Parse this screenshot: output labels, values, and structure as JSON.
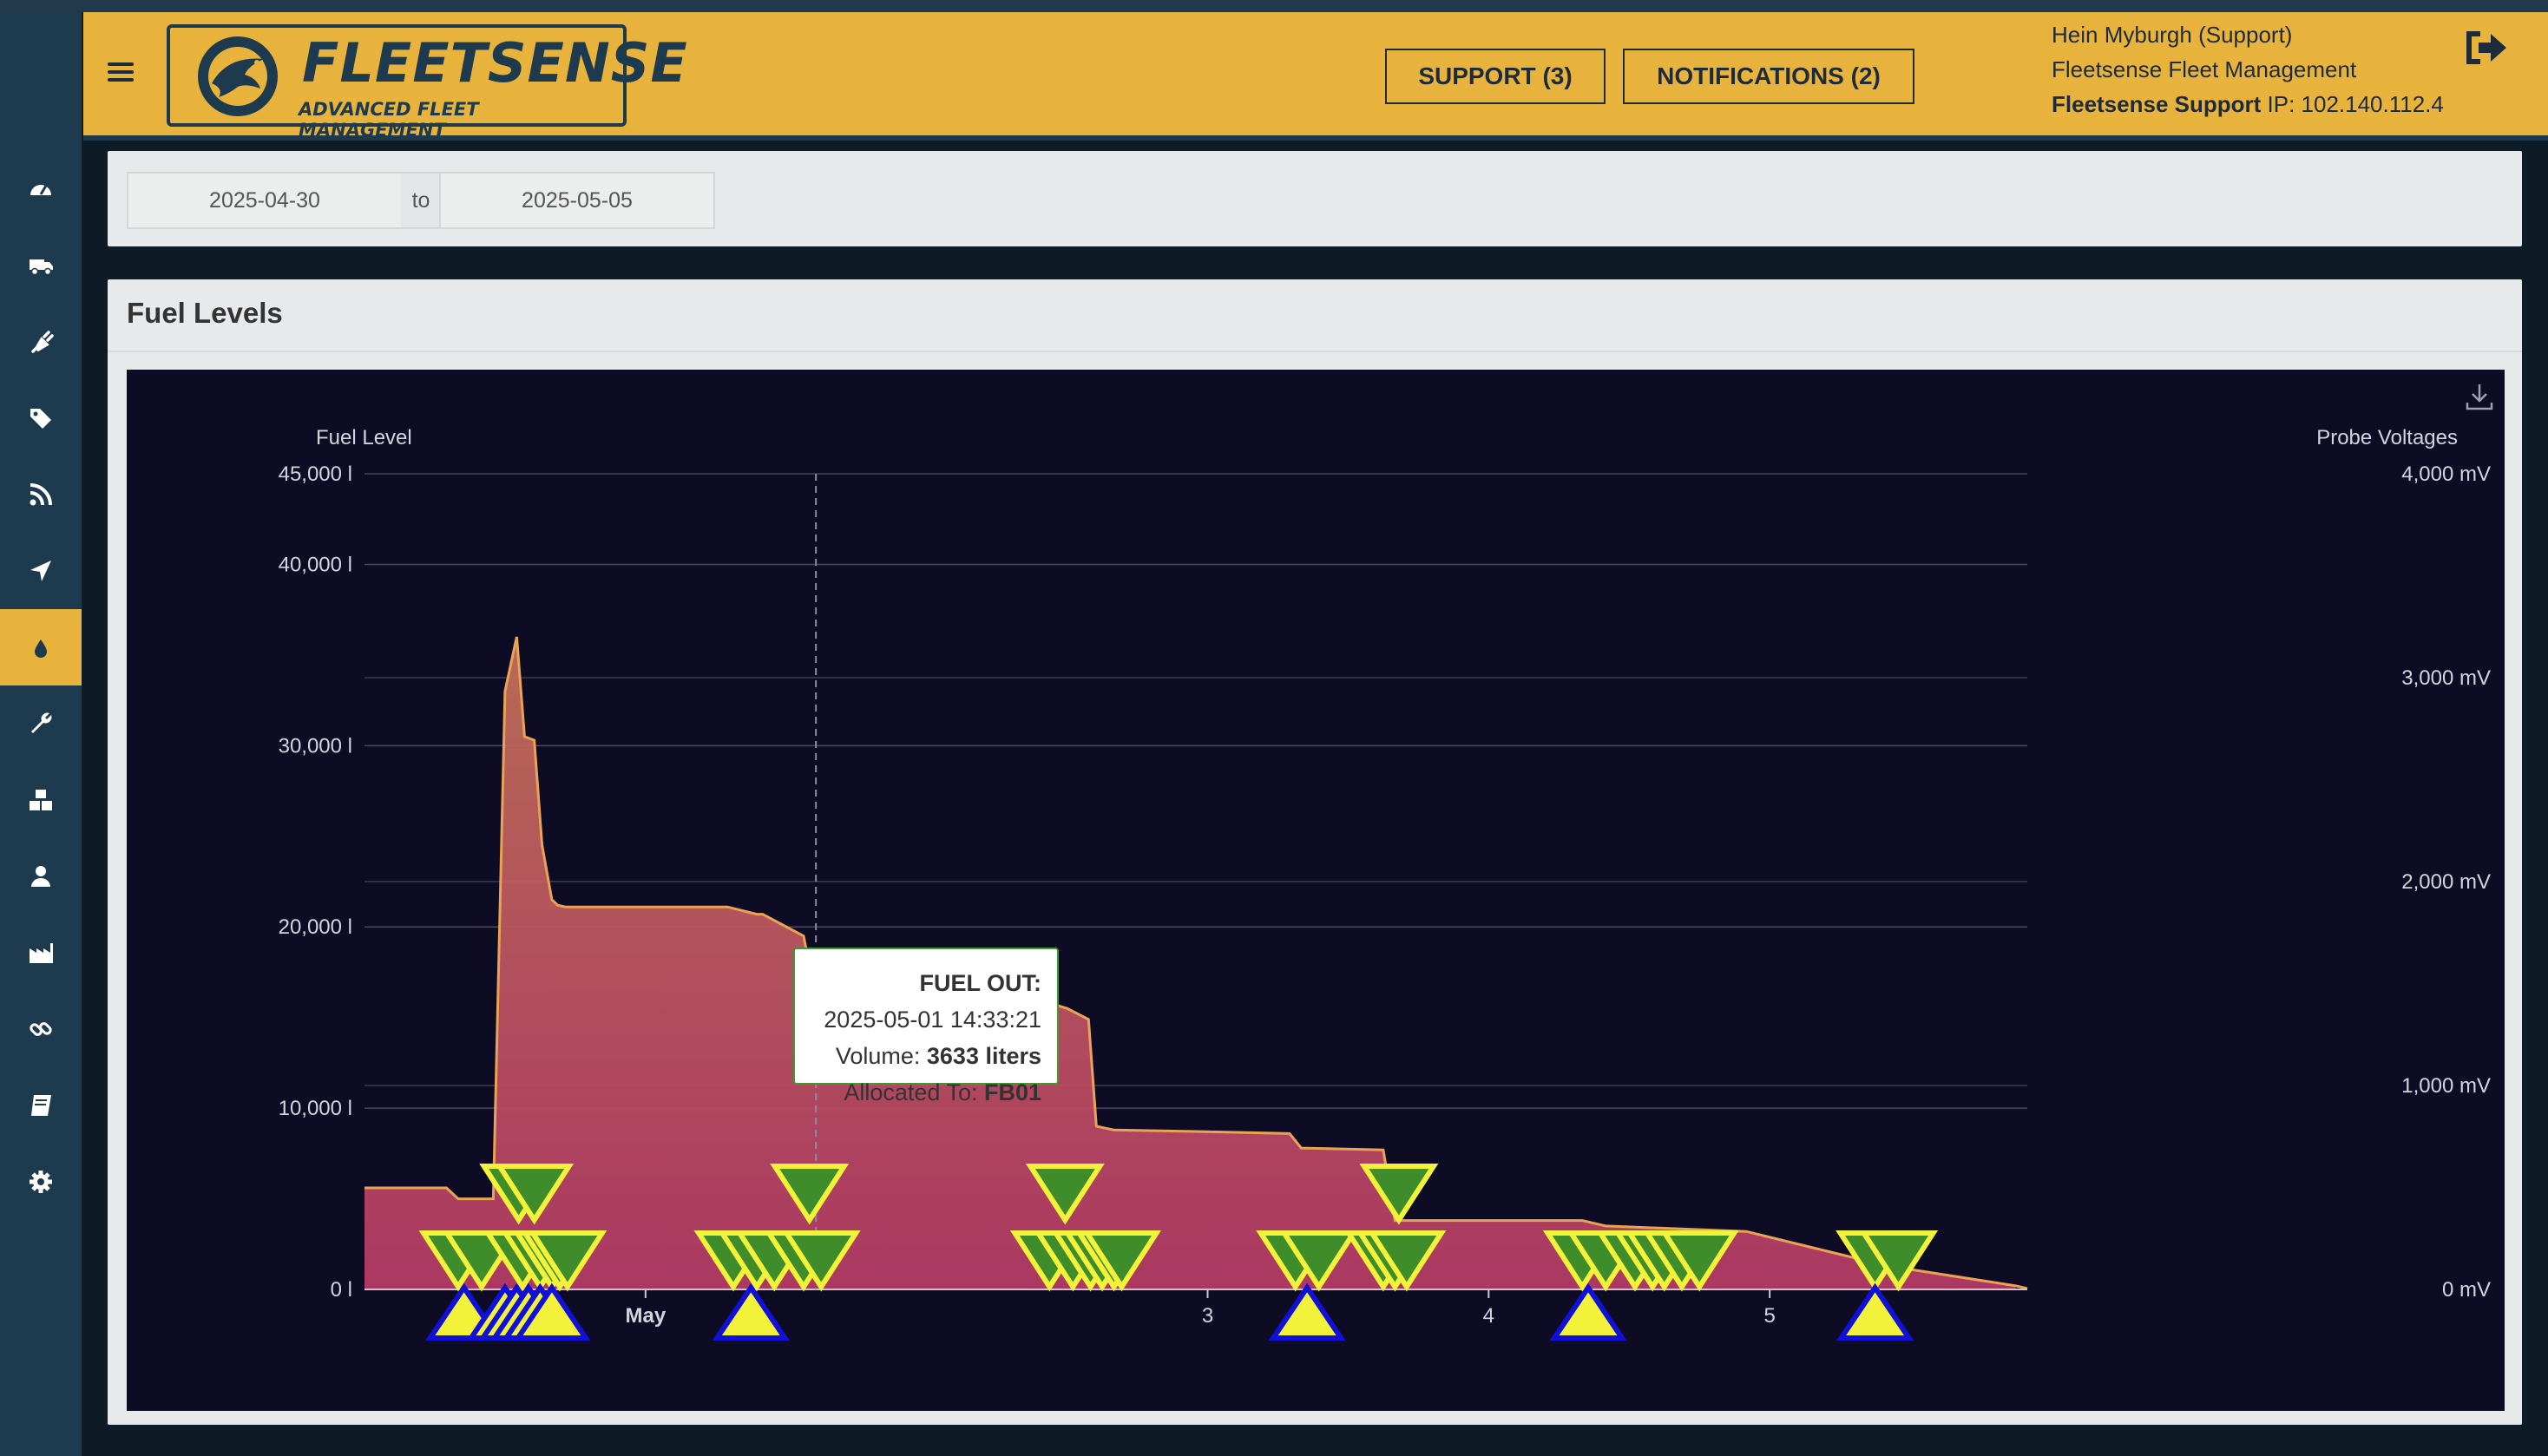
{
  "colors": {
    "accent": "#e8b33d",
    "sidebar": "#1e3a4e",
    "chart_bg": "#0e0c25",
    "fuel_line": "#e9a355",
    "fuel_fill_top": "#c7715a",
    "fuel_fill_bottom": "#b83c67",
    "fuel_in_marker": "#f2f23a",
    "fuel_in_outline": "#1010d8",
    "fuel_out_marker": "#3f8c2a",
    "tooltip_border": "#3b9b2e"
  },
  "sidebar": {
    "items": [
      {
        "icon": "dashboard-icon",
        "active": false
      },
      {
        "icon": "truck-icon",
        "active": false
      },
      {
        "icon": "plug-icon",
        "active": false
      },
      {
        "icon": "tags-icon",
        "active": false
      },
      {
        "icon": "rss-icon",
        "active": false
      },
      {
        "icon": "location-arrow-icon",
        "active": false
      },
      {
        "icon": "fuel-drop-icon",
        "active": true
      },
      {
        "icon": "wrench-icon",
        "active": false
      },
      {
        "icon": "cubes-icon",
        "active": false
      },
      {
        "icon": "user-icon",
        "active": false
      },
      {
        "icon": "industry-icon",
        "active": false
      },
      {
        "icon": "link-icon",
        "active": false
      },
      {
        "icon": "book-icon",
        "active": false
      },
      {
        "icon": "gear-icon",
        "active": false
      }
    ]
  },
  "header": {
    "logo_title": "FLEETSENSE",
    "logo_subtitle": "ADVANCED FLEET MANAGEMENT",
    "support_label": "SUPPORT (3)",
    "notifications_label": "NOTIFICATIONS (2)",
    "user_name": "Hein Myburgh (Support)",
    "company": "Fleetsense Fleet Management",
    "account_label": "Fleetsense Support",
    "ip_text": " IP: 102.140.112.4"
  },
  "date_range": {
    "from": "2025-04-30",
    "separator": "to",
    "to": "2025-05-05"
  },
  "panel": {
    "title": "Fuel Levels"
  },
  "tooltip": {
    "heading": "FUEL OUT:",
    "timestamp": "2025-05-01 14:33:21",
    "volume_label": "Volume: ",
    "volume_value": "3633 liters",
    "allocated_label": "Allocated To: ",
    "allocated_value": "FB01"
  },
  "chart_data": {
    "type": "area",
    "x_start": "2025-04-30 00:00",
    "x_end": "2025-05-05 22:00",
    "x_tick_labels": [
      "May",
      "3",
      "4",
      "5"
    ],
    "x_tick_dates": [
      "2025-05-01 00:00",
      "2025-05-03 00:00",
      "2025-05-04 00:00",
      "2025-05-05 00:00"
    ],
    "left_axis": {
      "title": "Fuel Level",
      "ticks": [
        "0 l",
        "10,000 l",
        "20,000 l",
        "30,000 l",
        "40,000 l",
        "45,000 l"
      ],
      "tick_values": [
        0,
        10000,
        20000,
        30000,
        40000,
        45000
      ],
      "range": [
        0,
        45000
      ]
    },
    "right_axis": {
      "title": "Probe Voltages",
      "ticks": [
        "0 mV",
        "1,000 mV",
        "2,000 mV",
        "3,000 mV",
        "4,000 mV"
      ],
      "tick_values": [
        0,
        1000,
        2000,
        3000,
        4000
      ],
      "range": [
        0,
        4000
      ]
    },
    "series": [
      {
        "type": "area",
        "x": [
          "2025-04-30 00:00",
          "2025-04-30 07:00",
          "2025-04-30 08:00",
          "2025-04-30 11:00",
          "2025-04-30 12:00",
          "2025-04-30 13:00",
          "2025-04-30 13:40",
          "2025-04-30 14:30",
          "2025-04-30 15:10",
          "2025-04-30 16:00",
          "2025-04-30 16:30",
          "2025-04-30 17:10",
          "2025-04-30 18:10",
          "2025-05-01 07:00",
          "2025-05-01 09:30",
          "2025-05-01 10:00",
          "2025-05-01 13:30",
          "2025-05-01 14:33",
          "2025-05-01 15:00",
          "2025-05-02 10:00",
          "2025-05-02 12:00",
          "2025-05-02 13:50",
          "2025-05-02 14:30",
          "2025-05-02 16:00",
          "2025-05-03 00:00",
          "2025-05-03 07:00",
          "2025-05-03 08:00",
          "2025-05-03 15:00",
          "2025-05-03 16:00",
          "2025-05-04 08:00",
          "2025-05-04 10:00",
          "2025-05-04 22:00",
          "2025-05-05 10:00",
          "2025-05-05 11:00",
          "2025-05-05 21:00"
        ],
        "values": [
          5600,
          5600,
          5000,
          5000,
          33000,
          36000,
          30500,
          30300,
          24500,
          21500,
          21200,
          21100,
          21100,
          21100,
          20700,
          20700,
          19500,
          16000,
          15900,
          15900,
          15500,
          14900,
          9000,
          8800,
          8700,
          8600,
          7800,
          7700,
          3800,
          3800,
          3500,
          3200,
          1300,
          1200,
          200
        ]
      }
    ],
    "fuel_in_marker_times": [
      "2025-04-30 08:30",
      "2025-04-30 12:00",
      "2025-04-30 13:00",
      "2025-04-30 14:00",
      "2025-04-30 15:00",
      "2025-04-30 16:00",
      "2025-05-01 09:00",
      "2025-05-03 08:30",
      "2025-05-04 08:30",
      "2025-05-05 09:00"
    ],
    "fuel_out_marker_times": [
      "2025-04-30 08:00",
      "2025-04-30 10:00",
      "2025-04-30 13:30",
      "2025-04-30 15:00",
      "2025-04-30 16:00",
      "2025-04-30 16:40",
      "2025-04-30 17:20",
      "2025-05-01 07:30",
      "2025-05-01 09:30",
      "2025-05-01 11:00",
      "2025-05-01 13:30",
      "2025-05-01 15:00",
      "2025-05-02 10:30",
      "2025-05-02 12:30",
      "2025-05-02 14:00",
      "2025-05-02 15:00",
      "2025-05-02 16:00",
      "2025-05-02 16:40",
      "2025-05-03 07:30",
      "2025-05-03 09:30",
      "2025-05-03 15:00",
      "2025-05-03 16:00",
      "2025-05-03 17:00",
      "2025-05-04 08:00",
      "2025-05-04 10:00",
      "2025-05-04 12:30",
      "2025-05-04 14:00",
      "2025-05-04 15:00",
      "2025-05-04 16:30",
      "2025-05-04 18:00",
      "2025-05-05 09:00",
      "2025-05-05 11:00"
    ],
    "fuel_out_raised_marker_times": [
      "2025-04-30 13:10",
      "2025-04-30 14:30",
      "2025-05-01 14:00",
      "2025-05-02 11:50",
      "2025-05-03 16:20"
    ],
    "hover_time": "2025-05-01 14:33",
    "grid": true,
    "legend": "none"
  }
}
